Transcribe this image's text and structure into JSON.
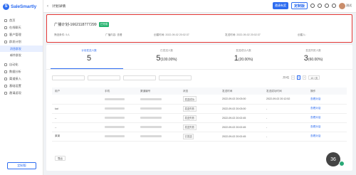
{
  "brand": {
    "name": "SaleSmartly"
  },
  "sidebar": {
    "items": [
      {
        "label": "首页"
      },
      {
        "label": "在线聊天"
      },
      {
        "label": "客户管理"
      },
      {
        "label": "群发计划"
      },
      {
        "label": "自动化"
      },
      {
        "label": "数据分析"
      },
      {
        "label": "渠道接入"
      },
      {
        "label": "基础设置"
      },
      {
        "label": "邀请返现"
      }
    ],
    "subitems": [
      {
        "label": "消息群发"
      },
      {
        "label": "邮件群发"
      }
    ],
    "footer": "定制版"
  },
  "topbar": {
    "back": "‹",
    "title": "计划详情",
    "upgrade": "邀请有奖",
    "custom": "定制版",
    "user": "测试"
  },
  "summary": {
    "plan_name": "广播计划-1662118777299",
    "status": "已完成",
    "meta": [
      "筛选条件: 5人",
      "广播内容: 查看",
      "创建时间: 2022-09-02 20:02:37",
      "发送时间: 2022-09-02 20:02:37",
      "创建人: "
    ]
  },
  "stats": [
    {
      "label": "计划发送人数",
      "value": "5",
      "pct": ""
    },
    {
      "label": "已发送人数",
      "value": "5",
      "pct": "(100.00%)"
    },
    {
      "label": "发送成功人数",
      "value": "1",
      "pct": "(20.00%)"
    },
    {
      "label": "发送失败人数",
      "value": "3",
      "pct": "(60.00%)"
    }
  ],
  "pager": {
    "total": "共5位",
    "prev": "‹",
    "page": "1",
    "next": "›",
    "size": "10 / 页"
  },
  "table": {
    "headers": [
      "用户",
      "手机",
      "渠道编号",
      "状态",
      "发送时间",
      "发送成功时间",
      "操作"
    ],
    "rows": [
      {
        "user": "",
        "status": "发送成功",
        "sent": "2022-09-02 20:03:00",
        "success": "2022-09-02 20:12:52",
        "op": "查看对话"
      },
      {
        "user": "kat",
        "status": "发送失败",
        "sent": "2022-09-02 20:03:00",
        "success": "-",
        "op": "查看对话"
      },
      {
        "user": "--",
        "status": "发送失败",
        "sent": "2022-09-02 20:02:45",
        "success": "-",
        "op": "查看对话"
      },
      {
        "user": "--",
        "status": "发送失败",
        "sent": "2022-09-02 20:02:45",
        "success": "-",
        "op": "查看对话"
      },
      {
        "user": "莱莱",
        "status": "已发送",
        "sent": "2022-09-02 20:02:45",
        "success": "-",
        "op": "查看对话"
      }
    ]
  },
  "export": "导出",
  "float_badge": "36"
}
